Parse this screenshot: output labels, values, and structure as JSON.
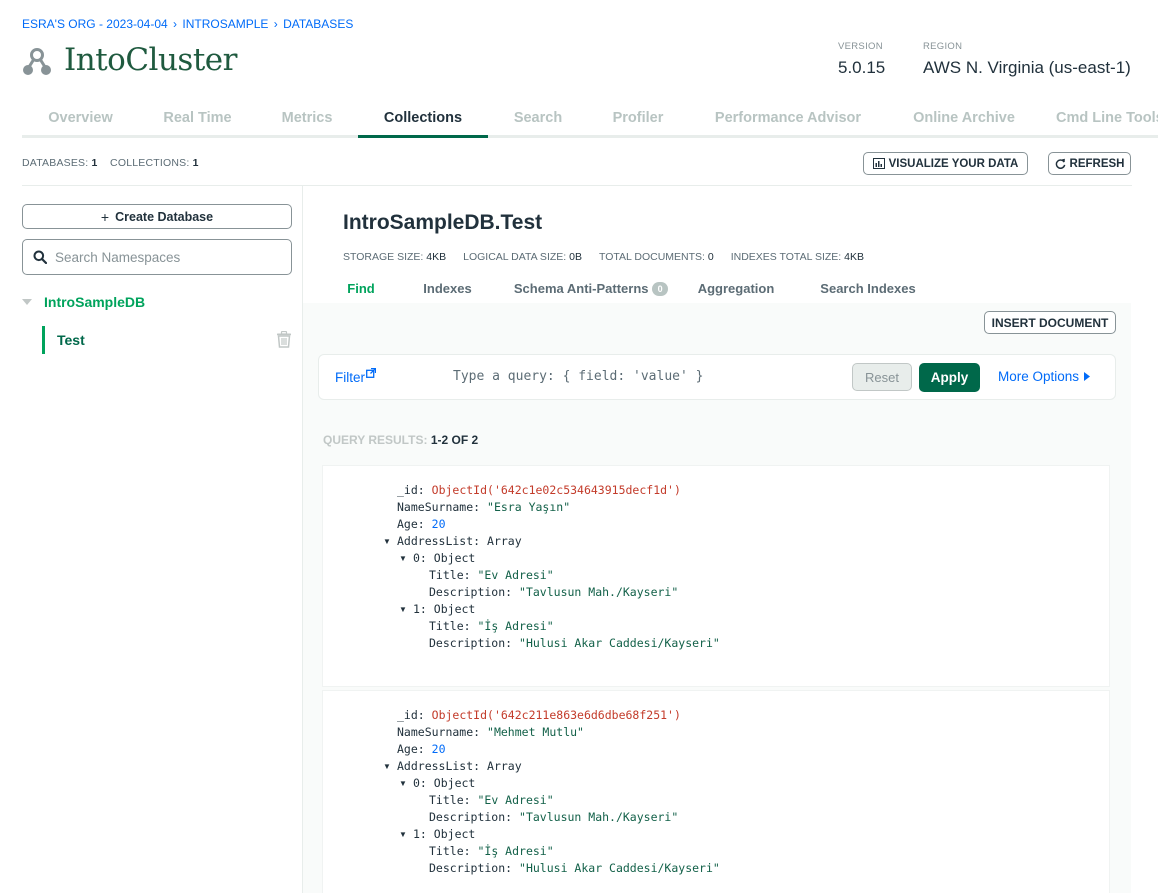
{
  "breadcrumb": {
    "org": "ESRA'S ORG - 2023-04-04",
    "project": "INTROSAMPLE",
    "section": "DATABASES"
  },
  "cluster": {
    "name": "IntoCluster",
    "version_label": "VERSION",
    "version": "5.0.15",
    "region_label": "REGION",
    "region": "AWS N. Virginia (us-east-1)"
  },
  "tabs": [
    "Overview",
    "Real Time",
    "Metrics",
    "Collections",
    "Search",
    "Profiler",
    "Performance Advisor",
    "Online Archive",
    "Cmd Line Tools"
  ],
  "active_tab": "Collections",
  "counts": {
    "databases_label": "DATABASES:",
    "databases": "1",
    "collections_label": "COLLECTIONS:",
    "collections": "1"
  },
  "toolbar": {
    "visualize": "VISUALIZE YOUR DATA",
    "refresh": "REFRESH"
  },
  "sidebar": {
    "create_db": "Create Database",
    "search_placeholder": "Search Namespaces",
    "database": "IntroSampleDB",
    "collection": "Test"
  },
  "namespace": {
    "title": "IntroSampleDB.Test",
    "storage_size": "STORAGE SIZE:",
    "storage_size_value": "4KB",
    "logical_size": "LOGICAL DATA SIZE:",
    "logical_size_value": "0B",
    "total_docs": "TOTAL DOCUMENTS:",
    "total_docs_value": "0",
    "indexes_size": "INDEXES TOTAL SIZE:",
    "indexes_size_value": "4KB"
  },
  "subtabs": {
    "find": "Find",
    "indexes": "Indexes",
    "schema": "Schema Anti-Patterns",
    "schema_badge": "0",
    "aggregation": "Aggregation",
    "search_indexes": "Search Indexes"
  },
  "insert_document": "INSERT DOCUMENT",
  "query": {
    "filter_label": "Filter",
    "placeholder": "Type a query: { field: 'value' }",
    "reset": "Reset",
    "apply": "Apply",
    "more_options": "More Options"
  },
  "results": {
    "label": "QUERY RESULTS:",
    "range": "1-2 OF 2"
  },
  "documents": [
    {
      "id_key": "_id:",
      "id_value": "ObjectId('642c1e02c534643915decf1d')",
      "name_key": "NameSurname:",
      "name_value": "\"Esra Yaşın\"",
      "age_key": "Age:",
      "age_value": "20",
      "list_key": "AddressList:",
      "list_type": "Array",
      "items": [
        {
          "idx": "0:",
          "type": "Object",
          "title_key": "Title:",
          "title": "\"Ev Adresi\"",
          "desc_key": "Description:",
          "desc": "\"Tavlusun Mah./Kayseri\""
        },
        {
          "idx": "1:",
          "type": "Object",
          "title_key": "Title:",
          "title": "\"İş Adresi\"",
          "desc_key": "Description:",
          "desc": "\"Hulusi Akar Caddesi/Kayseri\""
        }
      ]
    },
    {
      "id_key": "_id:",
      "id_value": "ObjectId('642c211e863e6d6dbe68f251')",
      "name_key": "NameSurname:",
      "name_value": "\"Mehmet Mutlu\"",
      "age_key": "Age:",
      "age_value": "20",
      "list_key": "AddressList:",
      "list_type": "Array",
      "items": [
        {
          "idx": "0:",
          "type": "Object",
          "title_key": "Title:",
          "title": "\"Ev Adresi\"",
          "desc_key": "Description:",
          "desc": "\"Tavlusun Mah./Kayseri\""
        },
        {
          "idx": "1:",
          "type": "Object",
          "title_key": "Title:",
          "title": "\"İş Adresi\"",
          "desc_key": "Description:",
          "desc": "\"Hulusi Akar Caddesi/Kayseri\""
        }
      ]
    }
  ],
  "colors": {
    "brand_green": "#00684a",
    "accent_green": "#00a35c",
    "link_blue": "#016bf8",
    "objectid_red": "#c33b2a"
  }
}
